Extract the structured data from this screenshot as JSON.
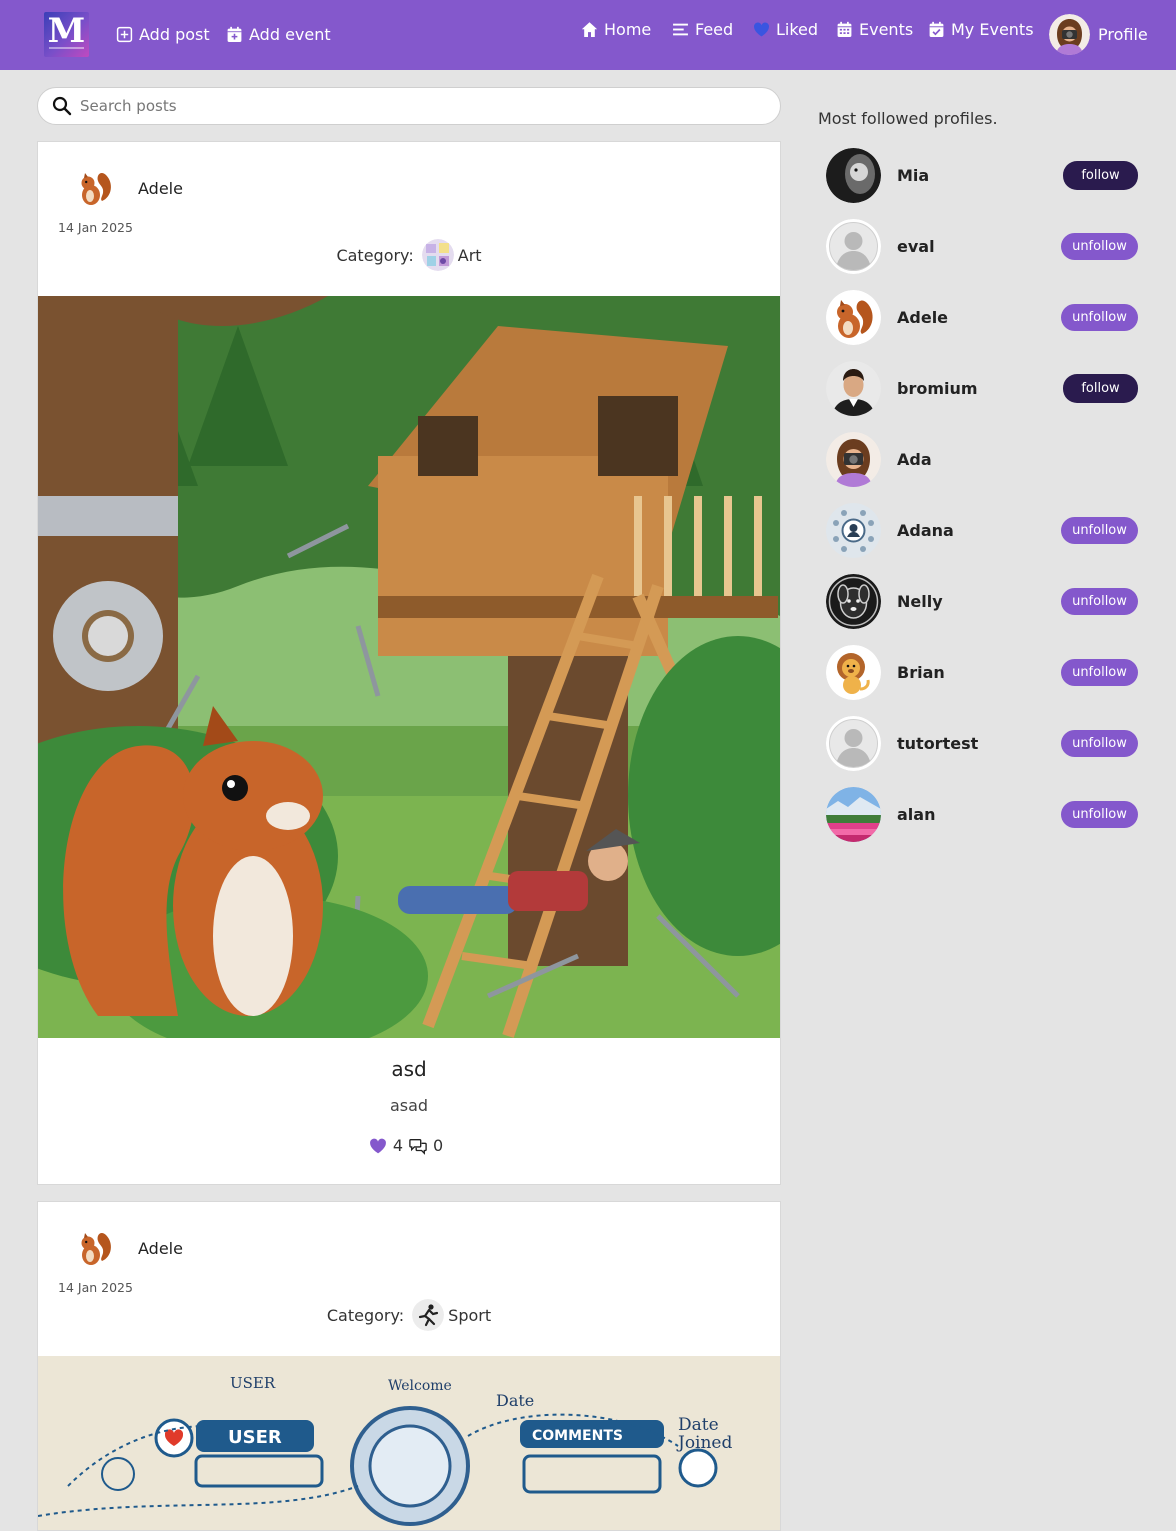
{
  "navbar": {
    "logo_letter": "M",
    "add_post": "Add post",
    "add_event": "Add event",
    "home": "Home",
    "feed": "Feed",
    "liked": "Liked",
    "events": "Events",
    "my_events": "My Events",
    "profile": "Profile",
    "icons": [
      "plus-square-icon",
      "calendar-plus-icon",
      "home-icon",
      "feed-lines-icon",
      "heart-icon",
      "calendar-icon",
      "calendar-check-icon"
    ]
  },
  "search": {
    "placeholder": "Search posts"
  },
  "posts": [
    {
      "author": "Adele",
      "date": "14 Jan 2025",
      "category_label": "Category:",
      "category": "Art",
      "title": "asd",
      "body": "asad",
      "likes": "4",
      "comments": "0"
    },
    {
      "author": "Adele",
      "date": "14 Jan 2025",
      "category_label": "Category:",
      "category": "Sport"
    }
  ],
  "sidebar": {
    "title": "Most followed profiles.",
    "profiles": [
      {
        "name": "Mia",
        "action": "follow"
      },
      {
        "name": "eval",
        "action": "unfollow"
      },
      {
        "name": "Adele",
        "action": "unfollow"
      },
      {
        "name": "bromium",
        "action": "follow"
      },
      {
        "name": "Ada",
        "action": ""
      },
      {
        "name": "Adana",
        "action": "unfollow"
      },
      {
        "name": "Nelly",
        "action": "unfollow"
      },
      {
        "name": "Brian",
        "action": "unfollow"
      },
      {
        "name": "tutortest",
        "action": "unfollow"
      },
      {
        "name": "alan",
        "action": "unfollow"
      }
    ]
  },
  "colors": {
    "nav_bg": "#8458cc",
    "follow_btn": "#2a1b4e",
    "unfollow_btn": "#8458cc",
    "page_bg": "#e4e4e4",
    "like_heart": "#8458cc"
  }
}
